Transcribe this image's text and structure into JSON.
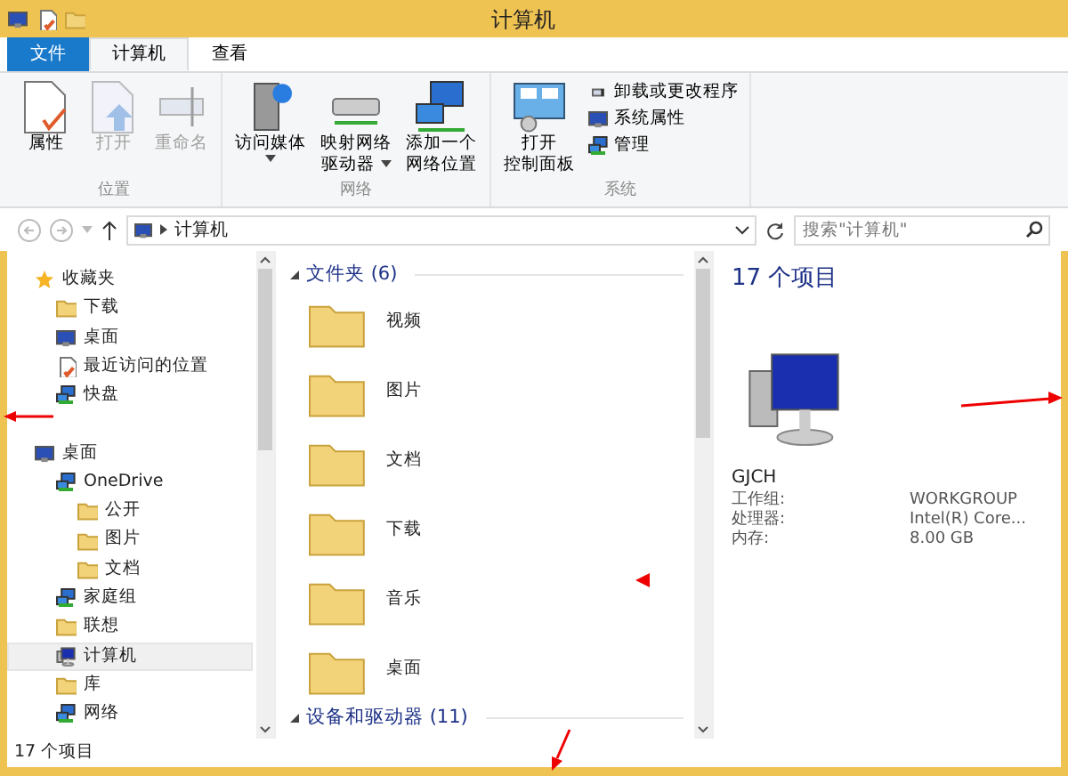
{
  "window": {
    "title": "计算机"
  },
  "ribbon_tabs": [
    {
      "label": "文件",
      "kind": "file",
      "selected": false
    },
    {
      "label": "计算机",
      "kind": "tab",
      "selected": true
    },
    {
      "label": "查看",
      "kind": "tab",
      "selected": false
    }
  ],
  "ribbon_groups": [
    {
      "label": "位置",
      "buttons": [
        {
          "kind": "large",
          "lines": [
            "属性"
          ],
          "disabled": false,
          "menu": false
        },
        {
          "kind": "large",
          "lines": [
            "打开"
          ],
          "disabled": true,
          "menu": false
        },
        {
          "kind": "large",
          "lines": [
            "重命名"
          ],
          "disabled": true,
          "menu": false
        }
      ]
    },
    {
      "label": "网络",
      "buttons": [
        {
          "kind": "large",
          "lines": [
            "访问媒体"
          ],
          "disabled": false,
          "menu": true
        },
        {
          "kind": "large",
          "lines": [
            "映射网络",
            "驱动器"
          ],
          "disabled": false,
          "menu": true
        },
        {
          "kind": "large",
          "lines": [
            "添加一个",
            "网络位置"
          ],
          "disabled": false,
          "menu": false
        }
      ]
    },
    {
      "label": "系统",
      "buttons": [
        {
          "kind": "large",
          "lines": [
            "打开",
            "控制面板"
          ],
          "disabled": false,
          "menu": false
        },
        {
          "kind": "small",
          "lines": [
            "卸载或更改程序"
          ]
        },
        {
          "kind": "small",
          "lines": [
            "系统属性"
          ]
        },
        {
          "kind": "small",
          "lines": [
            "管理"
          ]
        }
      ]
    }
  ],
  "address_bar": {
    "path": "计算机"
  },
  "search": {
    "placeholder": "搜索\"计算机\""
  },
  "navigation": [
    {
      "label": "收藏夹",
      "selected": false,
      "children": [
        {
          "label": "下载",
          "selected": false
        },
        {
          "label": "桌面",
          "selected": false
        },
        {
          "label": "最近访问的位置",
          "selected": false
        },
        {
          "label": "快盘",
          "selected": false
        }
      ]
    },
    {
      "label": "桌面",
      "selected": false,
      "children": [
        {
          "label": "OneDrive",
          "selected": false,
          "children": [
            {
              "label": "公开",
              "selected": false
            },
            {
              "label": "图片",
              "selected": false
            },
            {
              "label": "文档",
              "selected": false
            }
          ]
        },
        {
          "label": "家庭组",
          "selected": false
        },
        {
          "label": "联想",
          "selected": false
        },
        {
          "label": "计算机",
          "selected": true
        },
        {
          "label": "库",
          "selected": false
        },
        {
          "label": "网络",
          "selected": false
        }
      ]
    }
  ],
  "groups": [
    {
      "label": "文件夹 (6)",
      "items": [
        "视频",
        "图片",
        "文档",
        "下载",
        "音乐",
        "桌面"
      ]
    },
    {
      "label": "设备和驱动器 (11)"
    }
  ],
  "details": {
    "count": "17 个项目",
    "computer_name": "GJCH",
    "properties": [
      {
        "label": "工作组:",
        "value": "WORKGROUP"
      },
      {
        "label": "处理器:",
        "value": "Intel(R) Core..."
      },
      {
        "label": "内存:",
        "value": "8.00 GB"
      }
    ]
  },
  "status_bar": {
    "text": "17 个项目"
  }
}
